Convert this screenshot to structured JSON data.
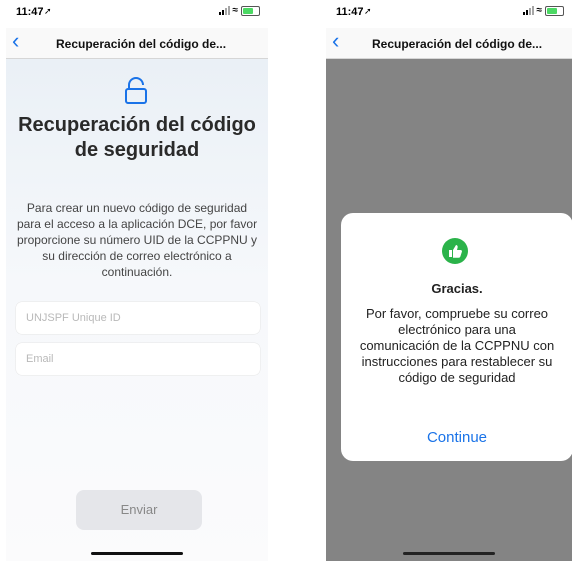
{
  "left": {
    "status": {
      "time": "11:47"
    },
    "nav": {
      "title": "Recuperación del código de..."
    },
    "main": {
      "heading": "Recuperación del código de seguridad",
      "description": "Para crear un nuevo código de seguridad para el acceso a la aplicación DCE, por favor proporcione su número UID de la CCPPNU y su dirección de correo electrónico a continuación.",
      "uid_placeholder": "UNJSPF Unique ID",
      "email_placeholder": "Email",
      "submit_label": "Enviar"
    }
  },
  "right": {
    "status": {
      "time": "11:47"
    },
    "nav": {
      "title": "Recuperación del código de..."
    },
    "dialog": {
      "title": "Gracias.",
      "message": "Por favor, compruebe su correo electrónico para una comunicación de la CCPPNU con instrucciones para restablecer su código de seguridad",
      "continue_label": "Continue"
    }
  },
  "colors": {
    "accent": "#1a73e8",
    "success": "#2bb34a",
    "overlay": "#848484"
  },
  "icons": [
    "back-chevron-icon",
    "unlock-icon",
    "thumbs-up-icon",
    "signal-icon",
    "wifi-icon",
    "battery-icon",
    "location-arrow-icon"
  ]
}
